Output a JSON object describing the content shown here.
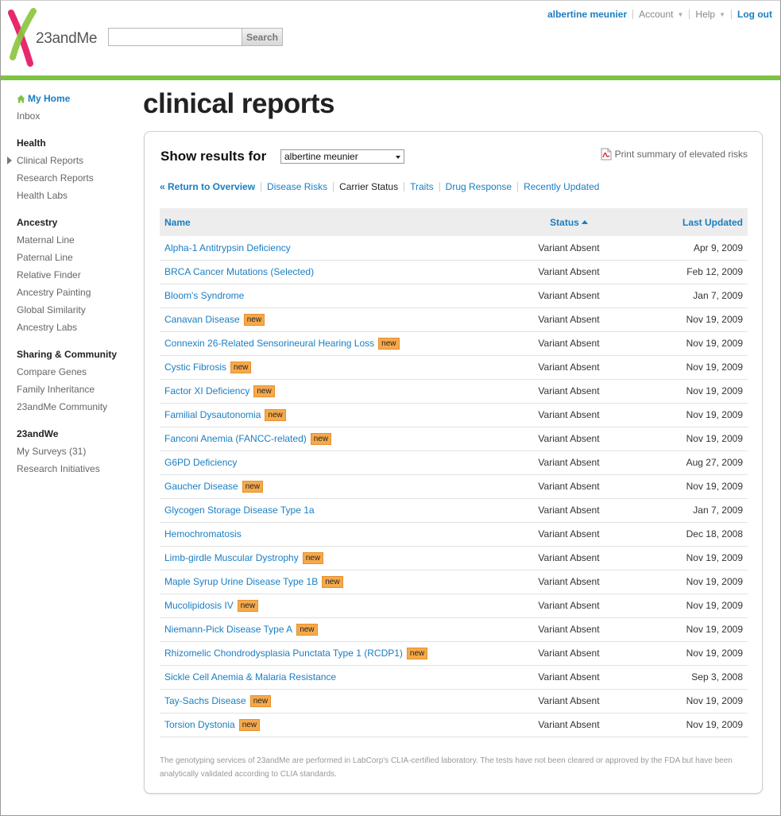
{
  "brand": {
    "name": "23andMe",
    "green": "#7dc242",
    "pink": "#e8286e",
    "link": "#1a7ec2"
  },
  "search": {
    "placeholder": "",
    "button_label": "Search"
  },
  "topnav": {
    "user": "albertine meunier",
    "account": "Account",
    "help": "Help",
    "logout": "Log out"
  },
  "sidebar": {
    "home": "My Home",
    "inbox": "Inbox",
    "health": {
      "heading": "Health",
      "items": [
        "Clinical Reports",
        "Research Reports",
        "Health Labs"
      ]
    },
    "ancestry": {
      "heading": "Ancestry",
      "items": [
        "Maternal Line",
        "Paternal Line",
        "Relative Finder",
        "Ancestry Painting",
        "Global Similarity",
        "Ancestry Labs"
      ]
    },
    "sharing": {
      "heading": "Sharing & Community",
      "items": [
        "Compare Genes",
        "Family Inheritance",
        "23andMe Community"
      ]
    },
    "we": {
      "heading": "23andWe",
      "items": [
        "My Surveys (31)",
        "Research Initiatives"
      ]
    }
  },
  "page": {
    "title": "clinical reports"
  },
  "panel": {
    "show_label": "Show results for",
    "selected_person": "albertine meunier",
    "print_link": "Print summary of elevated risks",
    "filters": {
      "overview": "« Return to Overview",
      "disease": "Disease Risks",
      "carrier": "Carrier Status",
      "traits": "Traits",
      "drug": "Drug Response",
      "recent": "Recently Updated"
    },
    "columns": {
      "name": "Name",
      "status": "Status",
      "updated": "Last Updated"
    },
    "new_badge": "new",
    "rows": [
      {
        "name": "Alpha-1 Antitrypsin Deficiency",
        "status": "Variant Absent",
        "date": "Apr 9, 2009",
        "new": false
      },
      {
        "name": "BRCA Cancer Mutations (Selected)",
        "status": "Variant Absent",
        "date": "Feb 12, 2009",
        "new": false
      },
      {
        "name": "Bloom's Syndrome",
        "status": "Variant Absent",
        "date": "Jan 7, 2009",
        "new": false
      },
      {
        "name": "Canavan Disease",
        "status": "Variant Absent",
        "date": "Nov 19, 2009",
        "new": true
      },
      {
        "name": "Connexin 26-Related Sensorineural Hearing Loss",
        "status": "Variant Absent",
        "date": "Nov 19, 2009",
        "new": true
      },
      {
        "name": "Cystic Fibrosis",
        "status": "Variant Absent",
        "date": "Nov 19, 2009",
        "new": true
      },
      {
        "name": "Factor XI Deficiency",
        "status": "Variant Absent",
        "date": "Nov 19, 2009",
        "new": true
      },
      {
        "name": "Familial Dysautonomia",
        "status": "Variant Absent",
        "date": "Nov 19, 2009",
        "new": true
      },
      {
        "name": "Fanconi Anemia (FANCC-related)",
        "status": "Variant Absent",
        "date": "Nov 19, 2009",
        "new": true
      },
      {
        "name": "G6PD Deficiency",
        "status": "Variant Absent",
        "date": "Aug 27, 2009",
        "new": false
      },
      {
        "name": "Gaucher Disease",
        "status": "Variant Absent",
        "date": "Nov 19, 2009",
        "new": true
      },
      {
        "name": "Glycogen Storage Disease Type 1a",
        "status": "Variant Absent",
        "date": "Jan 7, 2009",
        "new": false
      },
      {
        "name": "Hemochromatosis",
        "status": "Variant Absent",
        "date": "Dec 18, 2008",
        "new": false
      },
      {
        "name": "Limb-girdle Muscular Dystrophy",
        "status": "Variant Absent",
        "date": "Nov 19, 2009",
        "new": true
      },
      {
        "name": "Maple Syrup Urine Disease Type 1B",
        "status": "Variant Absent",
        "date": "Nov 19, 2009",
        "new": true
      },
      {
        "name": "Mucolipidosis IV",
        "status": "Variant Absent",
        "date": "Nov 19, 2009",
        "new": true
      },
      {
        "name": "Niemann-Pick Disease Type A",
        "status": "Variant Absent",
        "date": "Nov 19, 2009",
        "new": true
      },
      {
        "name": "Rhizomelic Chondrodysplasia Punctata Type 1 (RCDP1)",
        "status": "Variant Absent",
        "date": "Nov 19, 2009",
        "new": true
      },
      {
        "name": "Sickle Cell Anemia & Malaria Resistance",
        "status": "Variant Absent",
        "date": "Sep 3, 2008",
        "new": false
      },
      {
        "name": "Tay-Sachs Disease",
        "status": "Variant Absent",
        "date": "Nov 19, 2009",
        "new": true
      },
      {
        "name": "Torsion Dystonia",
        "status": "Variant Absent",
        "date": "Nov 19, 2009",
        "new": true
      }
    ],
    "footnote": "The genotyping services of 23andMe are performed in LabCorp's CLIA-certified laboratory. The tests have not been cleared or approved by the FDA but have been analytically validated according to CLIA standards."
  }
}
